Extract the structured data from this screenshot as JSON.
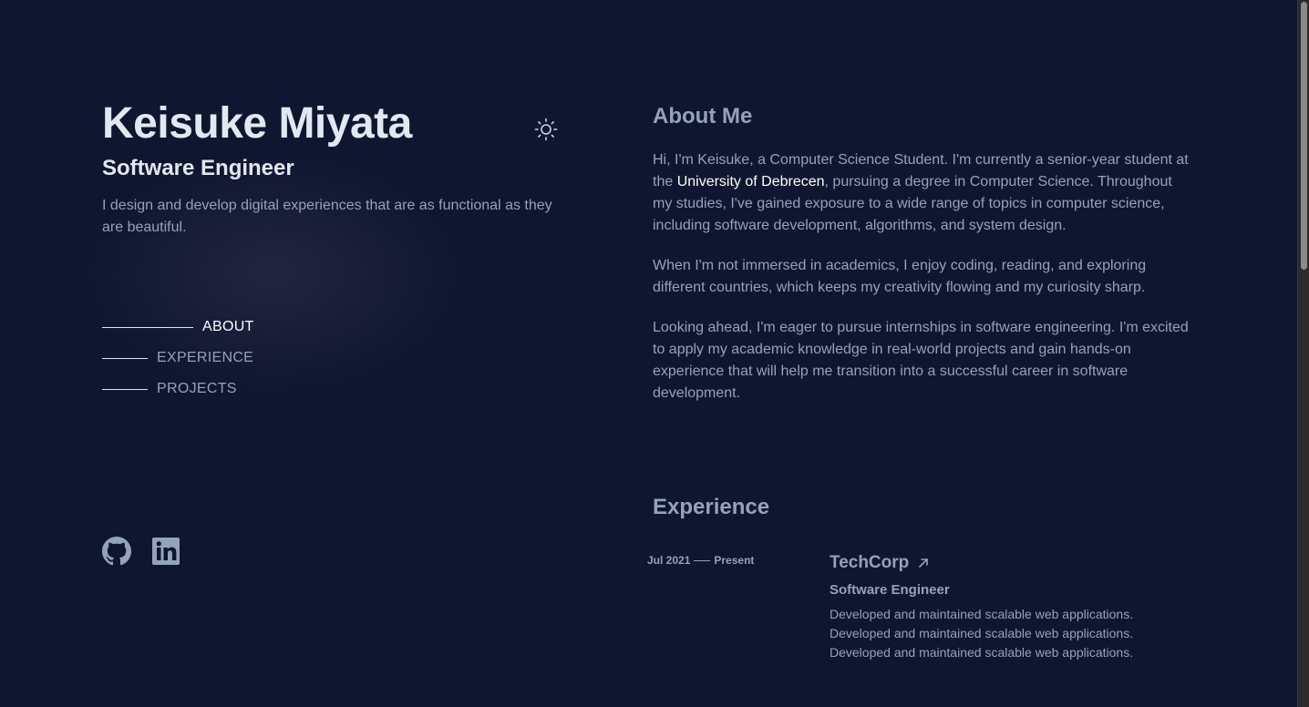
{
  "profile": {
    "name": "Keisuke Miyata",
    "role": "Software Engineer",
    "tagline": "I design and develop digital experiences that are as functional as they are beautiful."
  },
  "nav": [
    {
      "label": "ABOUT",
      "active": true
    },
    {
      "label": "EXPERIENCE",
      "active": false
    },
    {
      "label": "PROJECTS",
      "active": false
    }
  ],
  "icons": {
    "theme_toggle": "sun-icon",
    "social": [
      "github-icon",
      "linkedin-icon"
    ],
    "company_link": "arrow-up-right-icon"
  },
  "about": {
    "title": "About Me",
    "p1_before": "Hi, I'm Keisuke, a Computer Science Student. I'm currently a senior-year student at the ",
    "p1_highlight": "University of Debrecen",
    "p1_after": ", pursuing a degree in Computer Science. Throughout my studies, I've gained exposure to a wide range of topics in computer science, including software development, algorithms, and system design.",
    "p2": "When I'm not immersed in academics, I enjoy coding, reading, and exploring different countries, which keeps my creativity flowing and my curiosity sharp.",
    "p3": "Looking ahead, I'm eager to pursue internships in software engineering. I'm excited to apply my academic knowledge in real-world projects and gain hands-on experience that will help me transition into a successful career in software development."
  },
  "experience": {
    "title": "Experience",
    "items": [
      {
        "start": "Jul 2021",
        "end": "Present",
        "company": "TechCorp",
        "role": "Software Engineer",
        "descriptions": [
          "Developed and maintained scalable web applications.",
          "Developed and maintained scalable web applications.",
          "Developed and maintained scalable web applications."
        ]
      }
    ]
  },
  "colors": {
    "background": "#0f1630",
    "text_primary": "#e2e8f0",
    "text_muted": "#94a3b8",
    "highlight": "#ffffff"
  }
}
